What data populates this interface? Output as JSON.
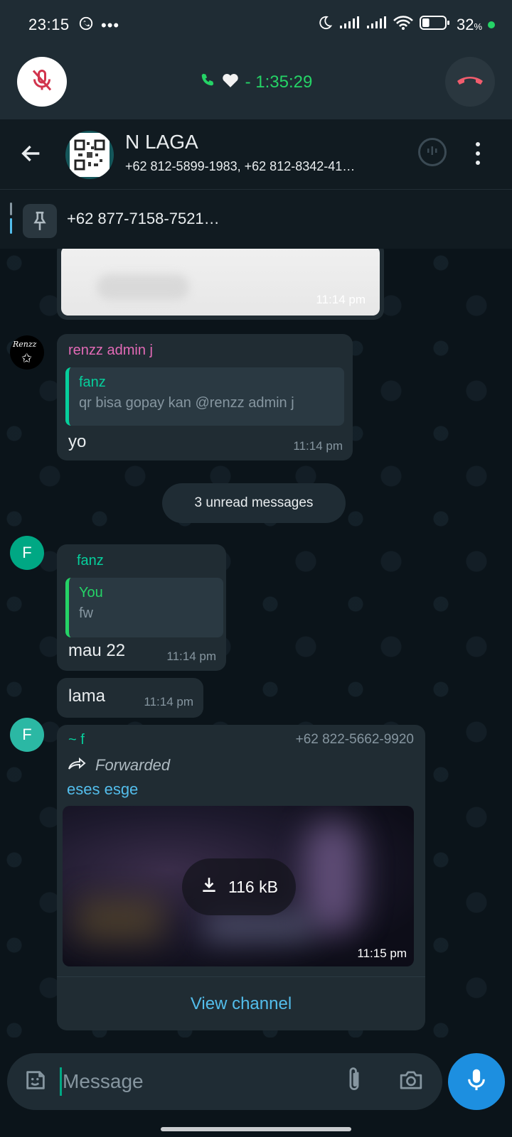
{
  "status_bar": {
    "time": "23:15",
    "battery_text": "32",
    "battery_percent_sign": "%",
    "battery_level": 0.32
  },
  "call": {
    "status_text": "- 1:35:29",
    "colors": {
      "accent": "#25d366",
      "end_call": "#f15c6d"
    }
  },
  "header": {
    "title": "N LAGA",
    "members": "+62 812-5899-1983, +62 812-8342-41…"
  },
  "pinned": {
    "text": "+62 877-7158-7521…"
  },
  "messages": {
    "m1": {
      "time": "11:14 pm"
    },
    "m2": {
      "avatar_text": "Renzz",
      "sender": "renzz admin j",
      "sender_color": "#e26ab6",
      "quote_name": "fanz",
      "quote_text": "qr bisa gopay kan @renzz admin j",
      "text": "yo",
      "time": "11:14 pm"
    },
    "unread": "3 unread messages",
    "m3": {
      "avatar_letter": "F",
      "sender": "fanz",
      "sender_color": "#06cf9c",
      "quote_name": "You",
      "quote_text": "fw",
      "text": "mau 22",
      "time": "11:14 pm"
    },
    "m4": {
      "text": "lama",
      "time": "11:14 pm"
    },
    "m5": {
      "avatar_letter": "F",
      "sender": "~ f",
      "phone": "+62 822-5662-9920",
      "forwarded": "Forwarded",
      "channel": "eses esge",
      "download_size": "116 kB",
      "time": "11:15 pm",
      "view_channel": "View channel"
    }
  },
  "input": {
    "placeholder": "Message"
  }
}
